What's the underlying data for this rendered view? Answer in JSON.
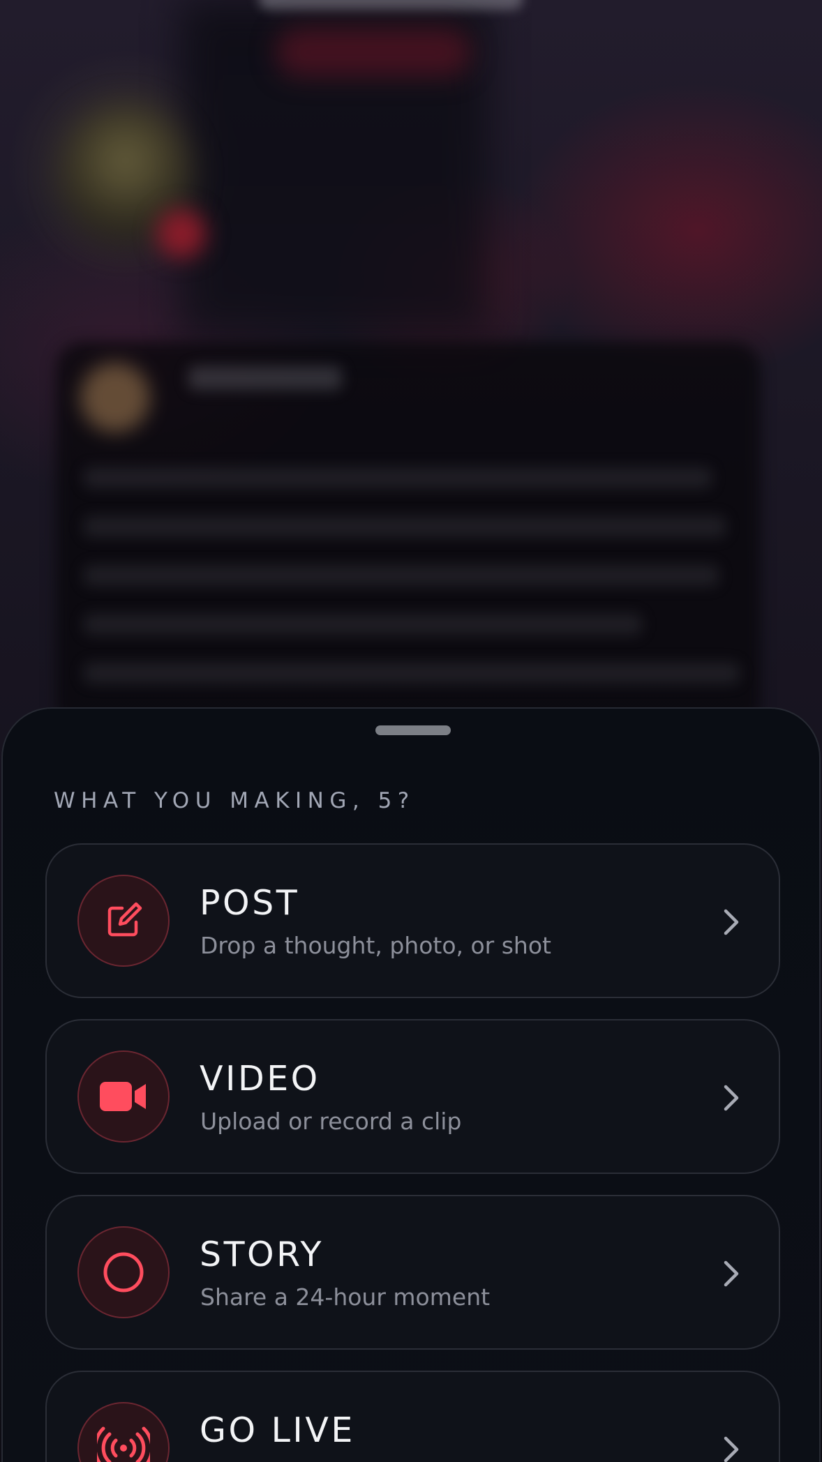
{
  "sheet": {
    "title": "WHAT YOU MAKING, 5?",
    "accent_color": "#ff4d5e",
    "options": [
      {
        "label": "POST",
        "subtitle": "Drop a thought, photo, or shot",
        "icon": "compose-icon"
      },
      {
        "label": "VIDEO",
        "subtitle": "Upload or record a clip",
        "icon": "video-camera-icon"
      },
      {
        "label": "STORY",
        "subtitle": "Share a 24-hour moment",
        "icon": "circle-icon"
      },
      {
        "label": "GO LIVE",
        "subtitle": "",
        "icon": "broadcast-icon"
      }
    ]
  }
}
